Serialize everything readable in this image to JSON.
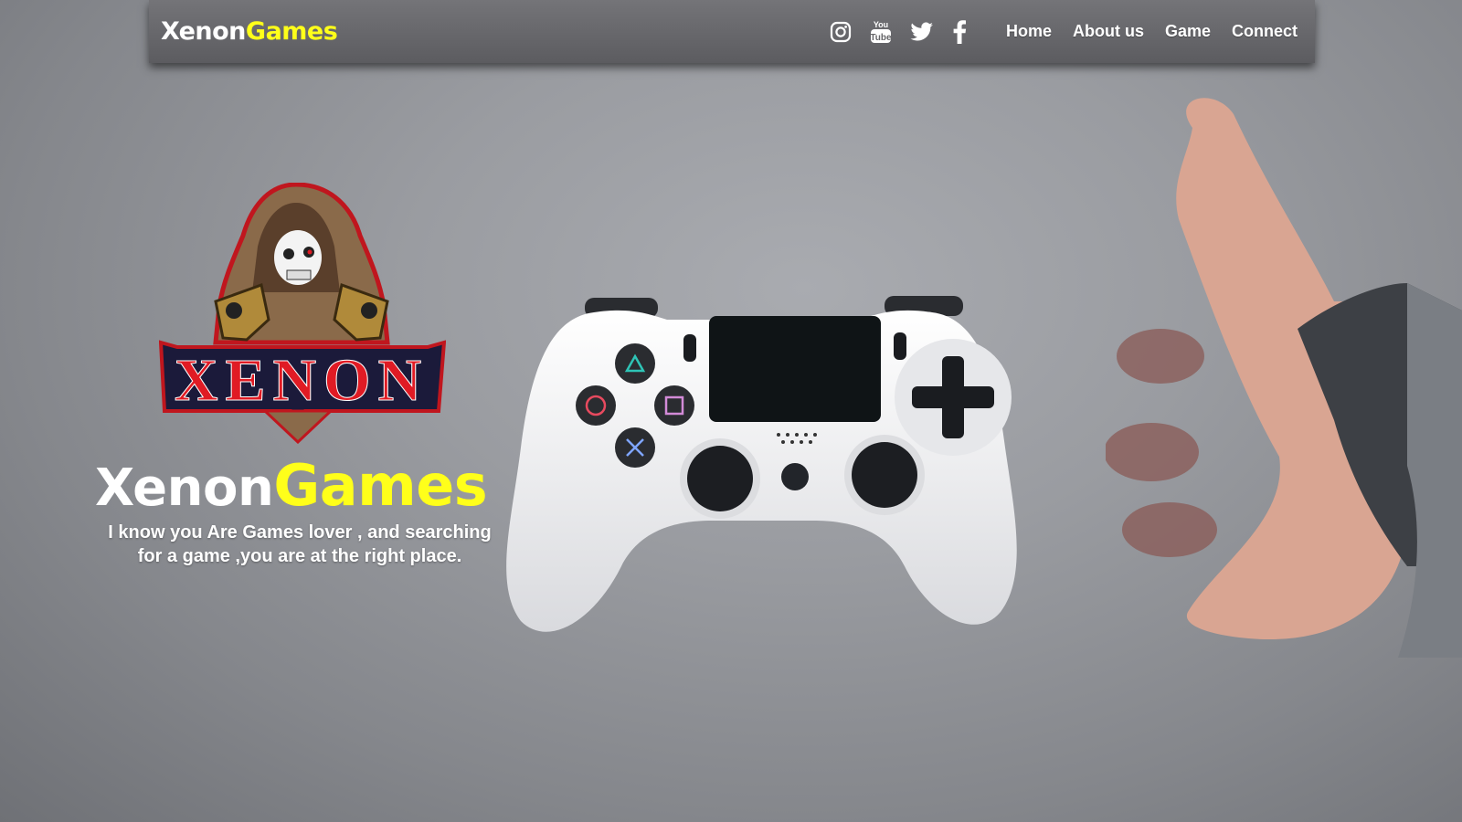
{
  "navbar": {
    "brand_part1": "Xenon",
    "brand_part2": "Games",
    "social_icons": [
      "instagram-icon",
      "youtube-icon",
      "twitter-icon",
      "facebook-icon"
    ],
    "links": [
      "Home",
      "About us",
      "Game",
      "Connect"
    ]
  },
  "logo": {
    "text": "XENON"
  },
  "hero": {
    "title_part1": "Xenon",
    "title_part2": "Games",
    "subtitle_line1": "I know you Are Games lover , and searching",
    "subtitle_line2": "for a game ,you are at the right place."
  },
  "colors": {
    "accent_yellow": "#ffff1a",
    "text_white": "#ffffff",
    "navbar_bg": "#666669",
    "logo_red": "#e01b24"
  }
}
